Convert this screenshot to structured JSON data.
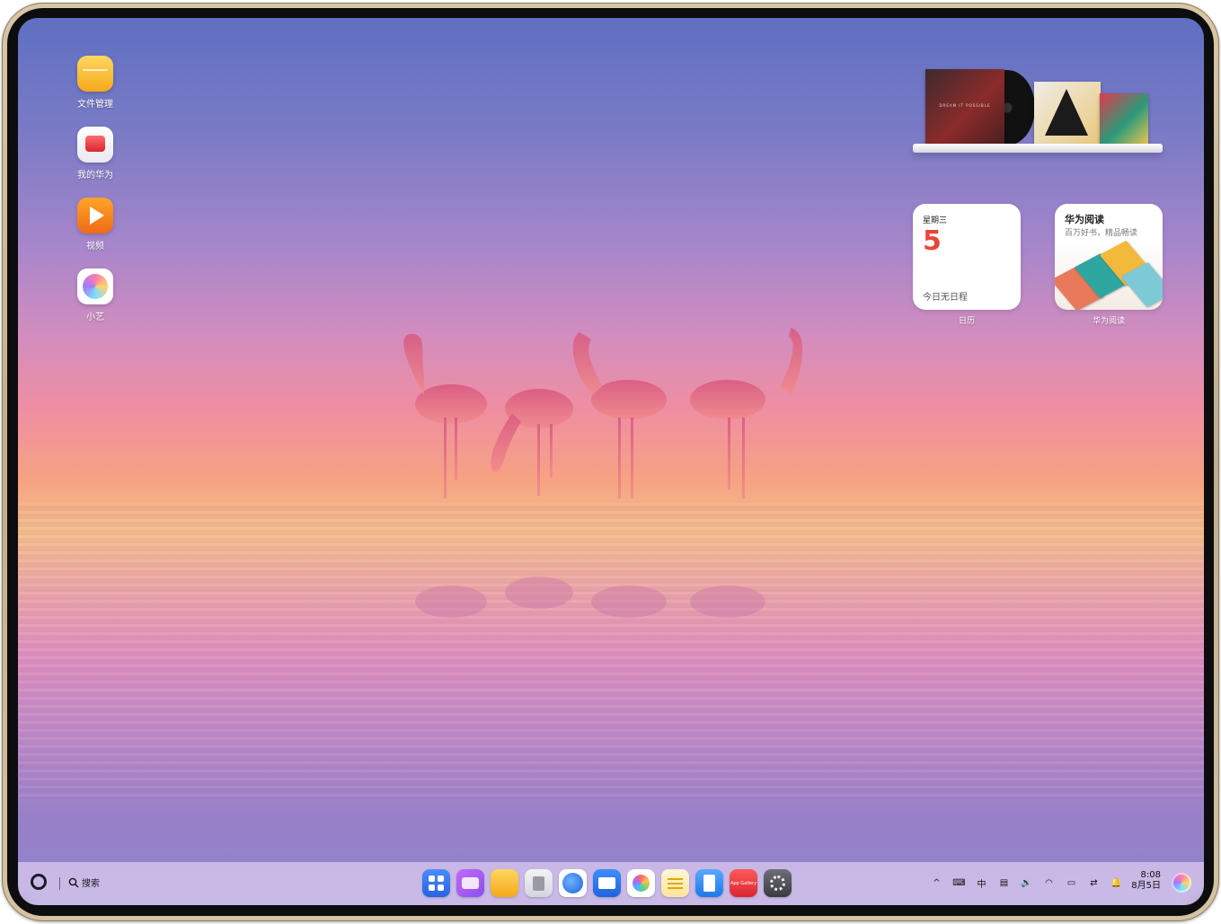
{
  "desktop": {
    "apps": [
      {
        "label": "文件管理",
        "icon": "folder-icon",
        "color": "#f5b81e"
      },
      {
        "label": "我的华为",
        "icon": "huawei-box-icon",
        "color": "#e8414b"
      },
      {
        "label": "视频",
        "icon": "video-play-icon",
        "color": "#f57a1e"
      },
      {
        "label": "小艺",
        "icon": "xiaoyi-orb-icon",
        "color": "#b18cff"
      }
    ]
  },
  "widgets": {
    "music": {
      "album_text": "DREAM IT POSSIBLE"
    },
    "calendar": {
      "weekday": "星期三",
      "day": "5",
      "empty_text": "今日无日程",
      "label": "日历"
    },
    "reading": {
      "title": "华为阅读",
      "subtitle": "百万好书，精品畅读",
      "label": "华为阅读"
    }
  },
  "taskbar": {
    "search_label": "搜索",
    "dock": [
      {
        "icon": "start-menu-icon",
        "color": "#3a7bf2"
      },
      {
        "icon": "multitask-icon",
        "color": "#b45cf0"
      },
      {
        "icon": "files-folder-icon",
        "color": "#f5b81e"
      },
      {
        "icon": "trash-bin-icon",
        "color": "#e8e8ec"
      },
      {
        "icon": "browser-icon",
        "color": "#2f7be6"
      },
      {
        "icon": "mail-icon",
        "color": "#1e6fe0"
      },
      {
        "icon": "gallery-icon",
        "color": "#ffffff"
      },
      {
        "icon": "notes-icon",
        "color": "#fff4cf"
      },
      {
        "icon": "docs-editor-icon",
        "color": "#2a88ea"
      },
      {
        "icon": "app-gallery-icon",
        "color": "#e8343f",
        "text": "App Gallery"
      },
      {
        "icon": "settings-gear-icon",
        "color": "#4a4a52"
      }
    ],
    "tray": {
      "chevron": "^",
      "input_method": "中"
    },
    "time": "8:08",
    "date": "8月5日"
  }
}
